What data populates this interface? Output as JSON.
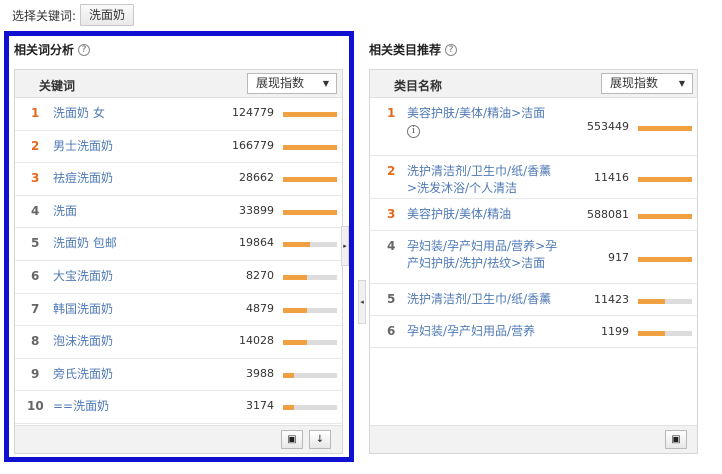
{
  "keyword_bar": {
    "label": "选择关键词:",
    "selected": "洗面奶"
  },
  "left_panel": {
    "title": "相关词分析",
    "column_header": "关键词",
    "metric_select": "展现指数",
    "rows": [
      {
        "rank": "1",
        "name": "洗面奶 女",
        "value": "124779",
        "level": 1.0
      },
      {
        "rank": "2",
        "name": "男士洗面奶",
        "value": "166779",
        "level": 1.0
      },
      {
        "rank": "3",
        "name": "祛痘洗面奶",
        "value": "28662",
        "level": 1.0
      },
      {
        "rank": "4",
        "name": "洗面",
        "value": "33899",
        "level": 1.0
      },
      {
        "rank": "5",
        "name": "洗面奶 包邮",
        "value": "19864",
        "level": 0.5
      },
      {
        "rank": "6",
        "name": "大宝洗面奶",
        "value": "8270",
        "level": 0.45
      },
      {
        "rank": "7",
        "name": "韩国洗面奶",
        "value": "4879",
        "level": 0.45
      },
      {
        "rank": "8",
        "name": "泡沫洗面奶",
        "value": "14028",
        "level": 0.45
      },
      {
        "rank": "9",
        "name": "旁氏洗面奶",
        "value": "3988",
        "level": 0.2
      },
      {
        "rank": "10",
        "name": "==洗面奶",
        "value": "3174",
        "level": 0.2
      }
    ],
    "footer_buttons": {
      "copy": "copy-icon",
      "download": "download-icon"
    }
  },
  "right_panel": {
    "title": "相关类目推荐",
    "column_header": "类目名称",
    "metric_select": "展现指数",
    "rows": [
      {
        "rank": "1",
        "name": "美容护肤/美体/精油>洁面",
        "value": "553449",
        "level": 1.0,
        "has_info": true
      },
      {
        "rank": "2",
        "name": "洗护清洁剂/卫生巾/纸/香薰>洗发沐浴/个人清洁",
        "value": "11416",
        "level": 1.0,
        "has_info": false
      },
      {
        "rank": "3",
        "name": "美容护肤/美体/精油",
        "value": "588081",
        "level": 1.0,
        "has_info": false
      },
      {
        "rank": "4",
        "name": "孕妇装/孕产妇用品/营养>孕产妇护肤/洗护/祛纹>洁面",
        "value": "917",
        "level": 1.0,
        "has_info": false
      },
      {
        "rank": "5",
        "name": "洗护清洁剂/卫生巾/纸/香薰",
        "value": "11423",
        "level": 0.5,
        "has_info": false
      },
      {
        "rank": "6",
        "name": "孕妇装/孕产妇用品/营养",
        "value": "1199",
        "level": 0.5,
        "has_info": false
      }
    ],
    "footer_buttons": {
      "copy": "copy-icon"
    }
  },
  "colors": {
    "accent_bar": "#f0a040",
    "rank_top": "#e36a1e",
    "link": "#4f7ab5",
    "highlight_box": "#1010d0"
  }
}
